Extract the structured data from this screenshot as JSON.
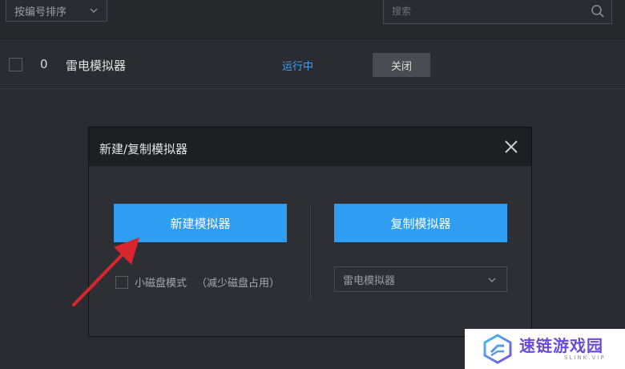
{
  "toolbar": {
    "sort_label": "按编号排序",
    "search_placeholder": "搜索"
  },
  "list": {
    "rows": [
      {
        "index": "0",
        "name": "雷电模拟器",
        "status": "运行中",
        "action_label": "关闭"
      }
    ]
  },
  "modal": {
    "title": "新建/复制模拟器",
    "new_button_label": "新建模拟器",
    "copy_button_label": "复制模拟器",
    "small_disk_label": "小磁盘模式",
    "small_disk_hint": "（减少磁盘占用）",
    "copy_source_selected": "雷电模拟器"
  },
  "watermark": {
    "title": "速链游戏园",
    "subtitle": "SLINK.VIP"
  },
  "colors": {
    "accent_blue": "#2f9ef2",
    "status_blue": "#3fa1f0",
    "arrow_red": "#d8262c",
    "watermark_purple": "#6a4bd8"
  }
}
